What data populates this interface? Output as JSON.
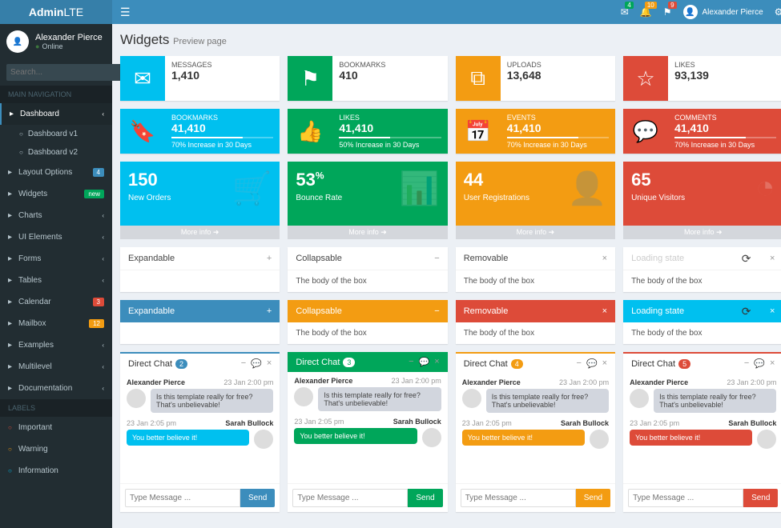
{
  "logo": {
    "bold": "Admin",
    "light": "LTE"
  },
  "user": {
    "name": "Alexander Pierce",
    "status": "Online"
  },
  "search": {
    "placeholder": "Search..."
  },
  "nav": {
    "header": "MAIN NAVIGATION",
    "items": [
      {
        "label": "Dashboard",
        "active": true
      },
      {
        "label": "Layout Options",
        "badge": "4",
        "badgeClass": "badge-blue"
      },
      {
        "label": "Widgets",
        "badge": "new",
        "badgeClass": "badge-green"
      },
      {
        "label": "Charts"
      },
      {
        "label": "UI Elements"
      },
      {
        "label": "Forms"
      },
      {
        "label": "Tables"
      },
      {
        "label": "Calendar",
        "badge": "3",
        "badgeClass": "badge-red"
      },
      {
        "label": "Mailbox",
        "badge": "12",
        "badgeClass": "badge-yellow"
      },
      {
        "label": "Examples"
      },
      {
        "label": "Multilevel"
      },
      {
        "label": "Documentation"
      }
    ],
    "sub": [
      {
        "label": "Dashboard v1"
      },
      {
        "label": "Dashboard v2"
      }
    ],
    "labelsHeader": "LABELS",
    "labels": [
      {
        "label": "Important",
        "color": "#dd4b39"
      },
      {
        "label": "Warning",
        "color": "#f39c12"
      },
      {
        "label": "Information",
        "color": "#00c0ef"
      }
    ]
  },
  "topbar": {
    "badges": {
      "mail": "4",
      "bell": "10",
      "flag": "9"
    },
    "user": "Alexander Pierce"
  },
  "page": {
    "title": "Widgets",
    "subtitle": "Preview page"
  },
  "infoBoxes1": [
    {
      "label": "MESSAGES",
      "value": "1,410",
      "bg": "bg-aqua",
      "icon": "✉"
    },
    {
      "label": "BOOKMARKS",
      "value": "410",
      "bg": "bg-green",
      "icon": "⚑"
    },
    {
      "label": "UPLOADS",
      "value": "13,648",
      "bg": "bg-yellow",
      "icon": "⧉"
    },
    {
      "label": "LIKES",
      "value": "93,139",
      "bg": "bg-red",
      "icon": "☆"
    }
  ],
  "infoBoxes2": [
    {
      "label": "BOOKMARKS",
      "value": "41,410",
      "bg": "bg-aqua",
      "icon": "🔖",
      "progress": "70% Increase in 30 Days",
      "pct": 70
    },
    {
      "label": "LIKES",
      "value": "41,410",
      "bg": "bg-green",
      "icon": "👍",
      "progress": "50% Increase in 30 Days",
      "pct": 50
    },
    {
      "label": "EVENTS",
      "value": "41,410",
      "bg": "bg-yellow",
      "icon": "📅",
      "progress": "70% Increase in 30 Days",
      "pct": 70
    },
    {
      "label": "COMMENTS",
      "value": "41,410",
      "bg": "bg-red",
      "icon": "💬",
      "progress": "70% Increase in 30 Days",
      "pct": 70
    }
  ],
  "smallBoxes": [
    {
      "value": "150",
      "label": "New Orders",
      "bg": "bg-aqua",
      "icon": "🛒"
    },
    {
      "value": "53",
      "suffix": "%",
      "label": "Bounce Rate",
      "bg": "bg-green",
      "icon": "📊"
    },
    {
      "value": "44",
      "label": "User Registrations",
      "bg": "bg-yellow",
      "icon": "👤"
    },
    {
      "value": "65",
      "label": "Unique Visitors",
      "bg": "bg-red",
      "icon": "◔"
    }
  ],
  "moreInfo": "More info",
  "defaultBoxes": [
    {
      "title": "Expandable",
      "tool": "+",
      "body": ""
    },
    {
      "title": "Collapsable",
      "tool": "−",
      "body": "The body of the box"
    },
    {
      "title": "Removable",
      "tool": "×",
      "body": "The body of the box"
    },
    {
      "title": "Loading state",
      "tool": "×",
      "body": "The body of the box",
      "loading": true
    }
  ],
  "solidBoxes": [
    {
      "title": "Expandable",
      "tool": "+",
      "hdr": "box-primary-h",
      "body": ""
    },
    {
      "title": "Collapsable",
      "tool": "−",
      "hdr": "box-warning-h",
      "body": "The body of the box"
    },
    {
      "title": "Removable",
      "tool": "×",
      "hdr": "box-danger-h",
      "body": "The body of the box"
    },
    {
      "title": "Loading state",
      "tool": "×",
      "hdr": "box-info-h",
      "body": "The body of the box",
      "loading": true
    }
  ],
  "chat": {
    "title": "Direct Chat",
    "msg1": {
      "name": "Alexander Pierce",
      "time": "23 Jan 2:00 pm",
      "text": "Is this template really for free? That's unbelievable!"
    },
    "msg2": {
      "name": "Sarah Bullock",
      "time": "23 Jan 2:05 pm",
      "text": "You better believe it!"
    },
    "placeholder": "Type Message ...",
    "send": "Send",
    "variants": [
      {
        "border": "box-border-primary",
        "badge": "2",
        "badgeBg": "#3c8dbc",
        "bubble": "bubble-aqua",
        "btnBg": "#3c8dbc"
      },
      {
        "border": "",
        "hdr": "box-border-success",
        "badge": "3",
        "badgeBg": "#fff",
        "badgeColor": "#00a65a",
        "bubble": "bubble-green",
        "btnBg": "#00a65a",
        "headerBg": "#00a65a"
      },
      {
        "border": "box-border-warning",
        "badge": "4",
        "badgeBg": "#f39c12",
        "bubble": "bubble-yellow",
        "btnBg": "#f39c12"
      },
      {
        "border": "box-border-danger",
        "badge": "5",
        "badgeBg": "#dd4b39",
        "bubble": "bubble-red",
        "btnBg": "#dd4b39"
      }
    ]
  }
}
